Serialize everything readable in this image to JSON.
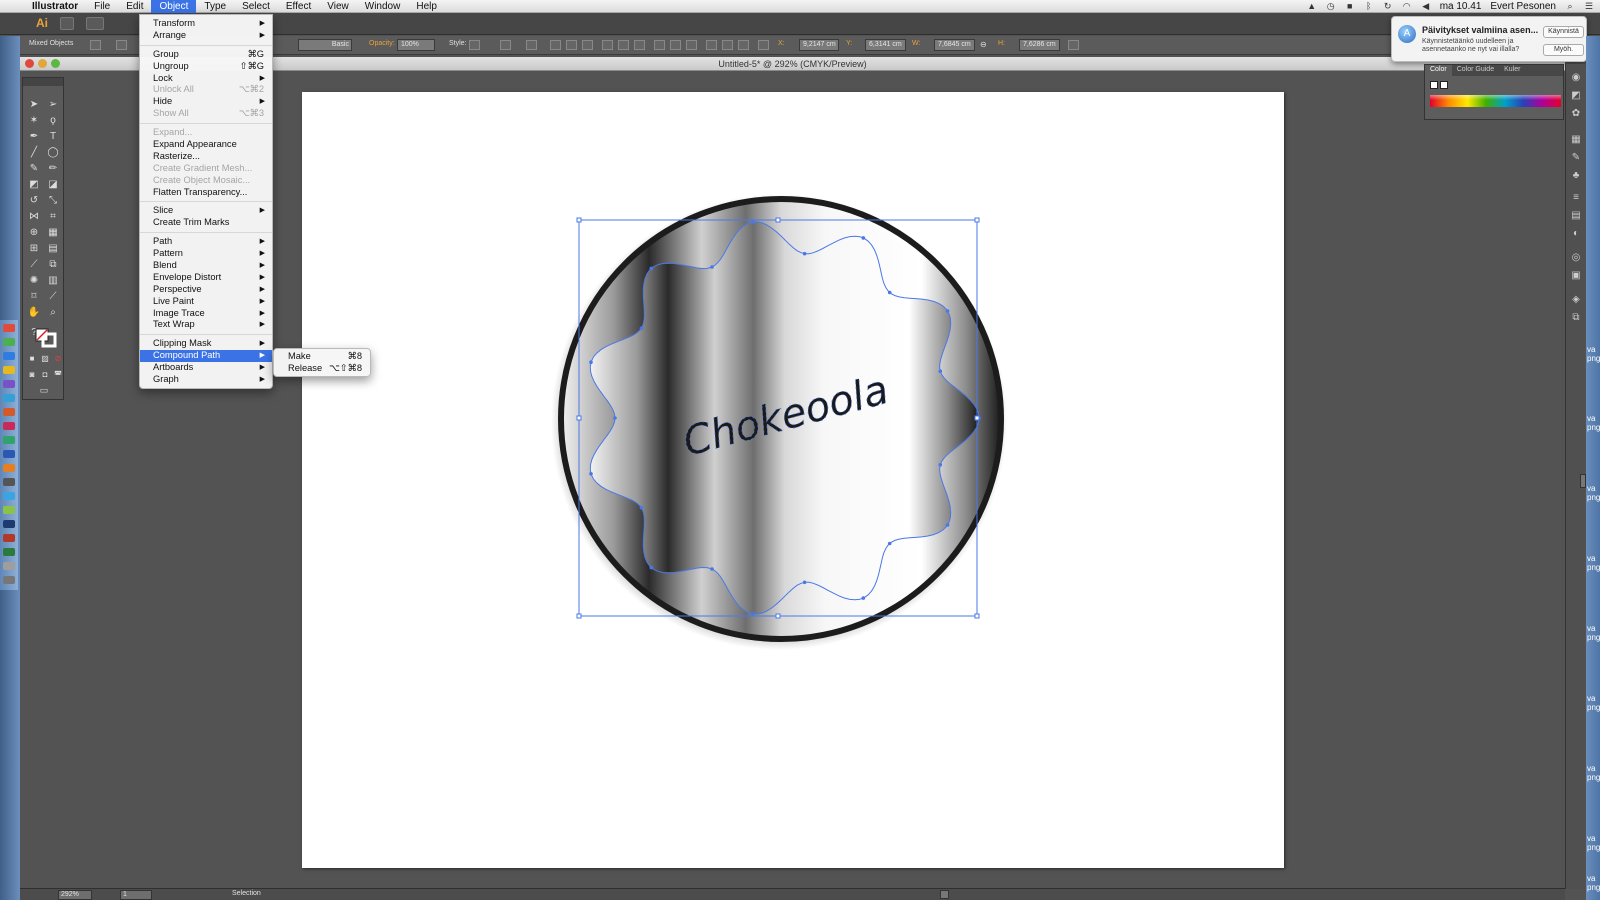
{
  "menubar": {
    "app": "Illustrator",
    "items": [
      "File",
      "Edit",
      "Object",
      "Type",
      "Select",
      "Effect",
      "View",
      "Window",
      "Help"
    ],
    "active": "Object",
    "clock": "ma 10.41",
    "user": "Evert Pesonen"
  },
  "appbar": {
    "logo": "Ai"
  },
  "controlbar": {
    "selection_label": "Mixed Objects",
    "stroke_style": "Basic",
    "opacity_label": "Opacity:",
    "opacity_value": "100%",
    "style_label": "Style:",
    "x_label": "X:",
    "x_value": "9,2147 cm",
    "y_label": "Y:",
    "y_value": "6,3141 cm",
    "w_label": "W:",
    "w_value": "7,6845 cm",
    "h_label": "H:",
    "h_value": "7,6286 cm"
  },
  "document": {
    "title": "Untitled-5* @ 292% (CMYK/Preview)"
  },
  "artwork": {
    "text": "Chokeoola"
  },
  "object_menu": {
    "groups": [
      [
        {
          "label": "Transform",
          "submenu": true
        },
        {
          "label": "Arrange",
          "submenu": true
        }
      ],
      [
        {
          "label": "Group",
          "shortcut": "⌘G"
        },
        {
          "label": "Ungroup",
          "shortcut": "⇧⌘G"
        },
        {
          "label": "Lock",
          "submenu": true
        },
        {
          "label": "Unlock All",
          "shortcut": "⌥⌘2",
          "disabled": true
        },
        {
          "label": "Hide",
          "submenu": true
        },
        {
          "label": "Show All",
          "shortcut": "⌥⌘3",
          "disabled": true
        }
      ],
      [
        {
          "label": "Expand...",
          "disabled": true
        },
        {
          "label": "Expand Appearance"
        },
        {
          "label": "Rasterize..."
        },
        {
          "label": "Create Gradient Mesh...",
          "disabled": true
        },
        {
          "label": "Create Object Mosaic...",
          "disabled": true
        },
        {
          "label": "Flatten Transparency..."
        }
      ],
      [
        {
          "label": "Slice",
          "submenu": true
        },
        {
          "label": "Create Trim Marks"
        }
      ],
      [
        {
          "label": "Path",
          "submenu": true
        },
        {
          "label": "Pattern",
          "submenu": true
        },
        {
          "label": "Blend",
          "submenu": true
        },
        {
          "label": "Envelope Distort",
          "submenu": true
        },
        {
          "label": "Perspective",
          "submenu": true
        },
        {
          "label": "Live Paint",
          "submenu": true
        },
        {
          "label": "Image Trace",
          "submenu": true
        },
        {
          "label": "Text Wrap",
          "submenu": true
        }
      ],
      [
        {
          "label": "Clipping Mask",
          "submenu": true
        },
        {
          "label": "Compound Path",
          "submenu": true,
          "highlight": true
        },
        {
          "label": "Artboards",
          "submenu": true
        },
        {
          "label": "Graph",
          "submenu": true
        }
      ]
    ]
  },
  "compound_submenu": [
    {
      "label": "Make",
      "shortcut": "⌘8"
    },
    {
      "label": "Release",
      "shortcut": "⌥⇧⌘8"
    }
  ],
  "notification": {
    "title": "Päivitykset valmiina asen...",
    "text": "Käynnistetäänkö uudelleen ja asennetaanko ne nyt vai illalla?",
    "primary_button": "Käynnistä",
    "secondary_button": "Myöh."
  },
  "color_panel": {
    "tabs": [
      "Color",
      "Color Guide",
      "Kuler"
    ]
  },
  "statusbar": {
    "zoom": "292%",
    "artboard": "1",
    "tool": "Selection"
  },
  "right_edge_labels": [
    "va",
    "png",
    "va",
    "png",
    "va",
    "png",
    "va",
    "png",
    "va",
    "png",
    "va",
    "png",
    "va",
    "png",
    "va",
    "png",
    "va",
    "png"
  ],
  "colors": {
    "menu_highlight": "#3b73e6",
    "selection": "#4a78e8",
    "orange_label": "#e9a23b"
  }
}
